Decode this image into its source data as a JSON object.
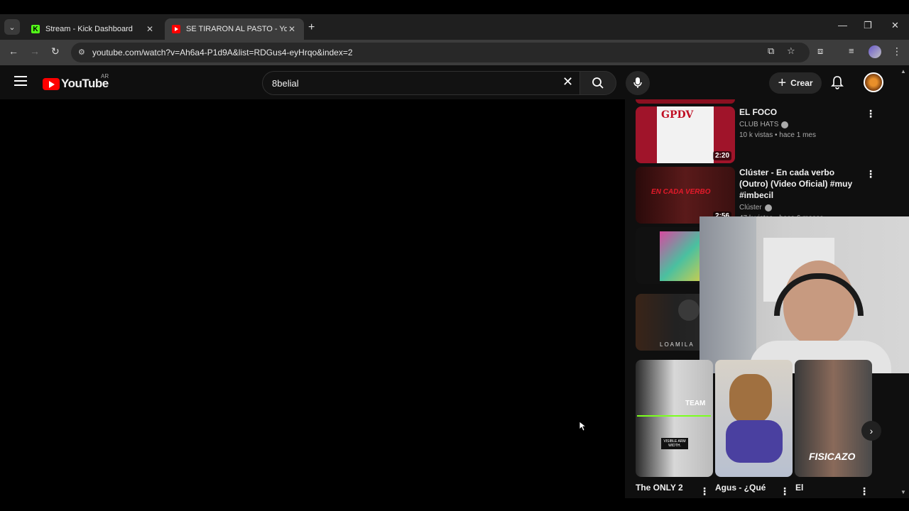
{
  "browser": {
    "tabs": [
      {
        "title": "Stream - Kick Dashboard",
        "icon": "kick-icon",
        "close": "✕"
      },
      {
        "title": "SE TIRARON AL PASTO - YouTube",
        "icon": "youtube-icon",
        "close": "✕"
      }
    ],
    "new_tab": "+",
    "window": {
      "minimize": "—",
      "restore": "❐",
      "close": "✕"
    },
    "address": "youtube.com/watch?v=Ah6a4-P1d9A&list=RDGus4-eyHrqo&index=2",
    "nav": {
      "back": "←",
      "forward": "→",
      "reload": "↻"
    }
  },
  "youtube": {
    "logo_text": "YouTube",
    "country_code": "AR",
    "search_value": "8belial",
    "create_label": "Crear",
    "create_plus": "+",
    "clear_glyph": "✕",
    "more_glyph": "⋮",
    "next_glyph": "›"
  },
  "recommendations": [
    {
      "title": "EL FOCO",
      "channel": "CLUB HATS",
      "stats": "10 k vistas • hace 1 mes",
      "duration": "2:20"
    },
    {
      "title": "Clúster - En cada verbo (Outro) (Video Oficial) #muy #imbecil",
      "channel": "Clúster",
      "stats": "47 k vistas • hace 6 meses",
      "duration": "2:56"
    }
  ],
  "shorts": [
    {
      "title": "The ONLY 2"
    },
    {
      "title": "Agus - ¿Qué"
    },
    {
      "title": "El"
    }
  ],
  "thumbnail_text": {
    "short1_overlay": "TEAM",
    "short1_label": "VISIBLE ARM WIDTH.",
    "short3_overlay": "FISICAZO",
    "rec4_overlay": "LOAMILA"
  },
  "colors": {
    "yt_red": "#ff0000",
    "bg": "#0f0f0f",
    "kick_green": "#53fc18"
  }
}
